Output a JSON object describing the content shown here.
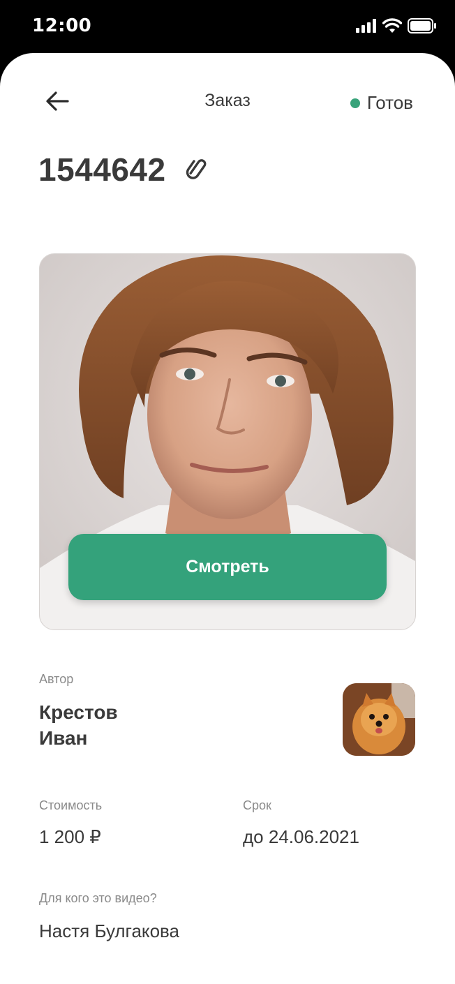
{
  "status_bar": {
    "time": "12:00",
    "icons": [
      "signal-icon",
      "wifi-icon",
      "battery-icon"
    ]
  },
  "nav": {
    "back_icon": "arrow-left-icon",
    "title": "Заказ",
    "status_label": "Готов",
    "status_color": "#38a37a"
  },
  "order": {
    "number": "1544642",
    "link_icon": "paperclip-icon"
  },
  "preview": {
    "watch_label": "Смотреть",
    "accent_color": "#34a27b"
  },
  "author": {
    "label": "Автор",
    "last_name": "Крестов",
    "first_name": "Иван"
  },
  "cost": {
    "label": "Стоимость",
    "value": "1 200 ₽"
  },
  "deadline": {
    "label": "Срок",
    "value": "до 24.06.2021"
  },
  "recipient": {
    "label": "Для кого это видео?",
    "value": "Настя Булгакова"
  }
}
